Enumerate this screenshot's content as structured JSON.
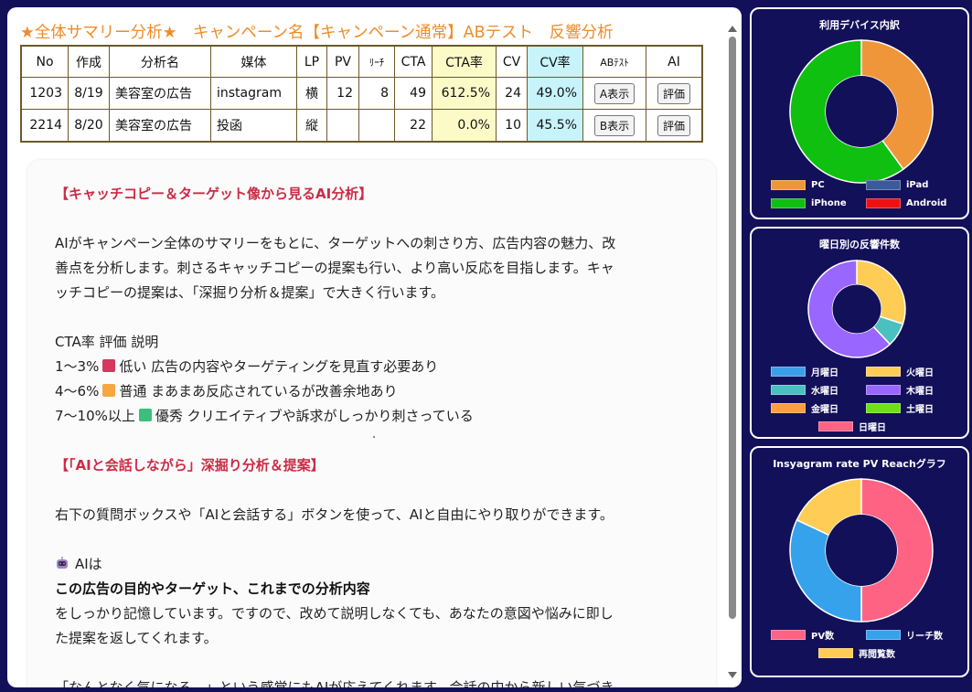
{
  "header": {
    "title": "★全体サマリー分析★　キャンペーン名【キャンペーン通常】ABテスト　反響分析"
  },
  "table": {
    "columns": [
      "No",
      "作成",
      "分析名",
      "媒体",
      "LP",
      "PV",
      "ﾘｰﾁ",
      "CTA",
      "CTA率",
      "CV",
      "CV率",
      "ABﾃｽﾄ",
      "AI"
    ],
    "rows": [
      {
        "no": "1203",
        "created": "8/19",
        "name": "美容室の広告",
        "media": "instagram",
        "lp": "横",
        "pv": "12",
        "reach": "8",
        "cta": "49",
        "cta_rate": "612.5%",
        "cv": "24",
        "cv_rate": "49.0%",
        "ab_button": "A表示",
        "ai_button": "評価"
      },
      {
        "no": "2214",
        "created": "8/20",
        "name": "美容室の広告",
        "media": "投函",
        "lp": "縦",
        "pv": "",
        "reach": "",
        "cta": "22",
        "cta_rate": "0.0%",
        "cv": "10",
        "cv_rate": "45.5%",
        "ab_button": "B表示",
        "ai_button": "評価"
      }
    ]
  },
  "analysis": {
    "heading1": "【キャッチコピー＆ターゲット像から見るAI分析】",
    "para1_line1": "AIがキャンペーン全体のサマリーをもとに、ターゲットへの刺さり方、広告内容の魅力、改",
    "para1_line2": "善点を分析します。刺さるキャッチコピーの提案も行い、より高い反応を目指します。キャ",
    "para1_line3": "ッチコピーの提案は、「深掘り分析＆提案」で大きく行います。",
    "legend_header": "CTA率 評価 説明",
    "rating1_range": "1〜3%",
    "rating1_text": "低い 広告の内容やターゲティングを見直す必要あり",
    "rating1_color": "#d6365f",
    "rating2_range": "4〜6%",
    "rating2_text": "普通 まあまあ反応されているが改善余地あり",
    "rating2_color": "#f6a742",
    "rating3_range": "7〜10%以上",
    "rating3_text": "優秀 クリエイティブや訴求がしっかり刺さっている",
    "rating3_color": "#3bbf7a",
    "heading2": "【「AIと会話しながら」深掘り分析＆提案】",
    "para2": "右下の質問ボックスや「AIと会話する」ボタンを使って、AIと自由にやり取りができます。",
    "ai_label": "AIは",
    "bold_line": "この広告の目的やターゲット、これまでの分析内容",
    "para3_line1": "をしっかり記憶しています。ですので、改めて説明しなくても、あなたの意図や悩みに即し",
    "para3_line2": "た提案を返してくれます。",
    "para4_cut": "「なんとなく気になる…」という感覚にもAIが応えてくれます。会話の中から新しい気づき"
  },
  "charts": {
    "device": {
      "title": "利用デバイス内訳",
      "legend": [
        {
          "label": "PC",
          "color": "#f0963a"
        },
        {
          "label": "iPad",
          "color": "#3a5a9a"
        },
        {
          "label": "iPhone",
          "color": "#10c010"
        },
        {
          "label": "Android",
          "color": "#ee1111"
        }
      ]
    },
    "weekday": {
      "title": "曜日別の反響件数",
      "legend": [
        {
          "label": "月曜日",
          "color": "#3a9fe8"
        },
        {
          "label": "火曜日",
          "color": "#ffcd56"
        },
        {
          "label": "水曜日",
          "color": "#4bc0c0"
        },
        {
          "label": "木曜日",
          "color": "#9966ff"
        },
        {
          "label": "金曜日",
          "color": "#ff9f40"
        },
        {
          "label": "土曜日",
          "color": "#6ee014"
        },
        {
          "label": "日曜日",
          "color": "#ff6384"
        }
      ]
    },
    "pv_reach": {
      "title": "Insyagram rate PV Reachグラフ",
      "legend": [
        {
          "label": "PV数",
          "color": "#ff6384"
        },
        {
          "label": "リーチ数",
          "color": "#36a2eb"
        },
        {
          "label": "再閲覧数",
          "color": "#ffcd56"
        }
      ]
    }
  },
  "chart_data": [
    {
      "type": "pie",
      "title": "利用デバイス内訳",
      "categories": [
        "PC",
        "iPad",
        "iPhone",
        "Android"
      ],
      "values": [
        40,
        0,
        60,
        0
      ],
      "colors": [
        "#f0963a",
        "#3a5a9a",
        "#10c010",
        "#ee1111"
      ]
    },
    {
      "type": "pie",
      "title": "曜日別の反響件数",
      "categories": [
        "月曜日",
        "火曜日",
        "水曜日",
        "木曜日",
        "金曜日",
        "土曜日",
        "日曜日"
      ],
      "values": [
        0,
        30,
        8,
        62,
        0,
        0,
        0
      ],
      "colors": [
        "#3a9fe8",
        "#ffcd56",
        "#4bc0c0",
        "#9966ff",
        "#ff9f40",
        "#6ee014",
        "#ff6384"
      ]
    },
    {
      "type": "pie",
      "title": "Insyagram rate PV Reachグラフ",
      "categories": [
        "PV数",
        "リーチ数",
        "再閲覧数"
      ],
      "values": [
        50,
        32,
        18
      ],
      "colors": [
        "#ff6384",
        "#36a2eb",
        "#ffcd56"
      ]
    }
  ]
}
